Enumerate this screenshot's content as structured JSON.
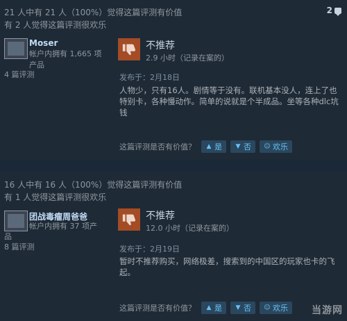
{
  "reviews": [
    {
      "helpful_text": "21 人中有 21 人（100%）觉得这篇评测有价值",
      "funny_text": "有 2 人觉得这篇评测很欢乐",
      "comment_count": "2",
      "username": "Moser",
      "owned_line1": "帐户内拥有 1,665 项",
      "owned_line2": "产品",
      "reviews_count": "4 篇评测",
      "recommendation": "不推荐",
      "hours": "2.9 小时（记录在案的）",
      "posted": "发布于：2月18日",
      "content": "人物少，只有16人。剧情等于没有。联机基本没人，连上了也特别卡，各种慢动作。简单的说就是个半成品。坐等各种dlc坑钱",
      "vote_question": "这篇评测是否有价值？",
      "yes_label": "是",
      "no_label": "否",
      "funny_label": "欢乐"
    },
    {
      "helpful_text": "16 人中有 16 人（100%）觉得这篇评测有价值",
      "funny_text": "有 1 人觉得这篇评测很欢乐",
      "username": "团战毒瘤周爸爸",
      "owned_line1": "帐户内拥有 37 项产",
      "owned_line2": "品",
      "reviews_count": "8 篇评测",
      "recommendation": "不推荐",
      "hours": "12.0 小时（记录在案的）",
      "posted": "发布于：2月19日",
      "content": "暂时不推荐购买，网络极差，搜索到的中国区的玩家也卡的飞起。",
      "vote_question": "这篇评测是否有价值？",
      "yes_label": "是",
      "no_label": "否",
      "funny_label": "欢乐"
    }
  ],
  "watermark": "当游网",
  "colors": {
    "thumb_down_bg": "#a34c25",
    "page_bg": "#1b2838",
    "vote_button_bg": "#2a475e",
    "link_blue": "#67c1f5"
  },
  "icons": [
    "comment-bubble-icon",
    "avatar-placeholder-icon",
    "thumbs-down-icon",
    "thumbs-up-icon",
    "thumbs-down-small-icon",
    "smiley-icon"
  ]
}
